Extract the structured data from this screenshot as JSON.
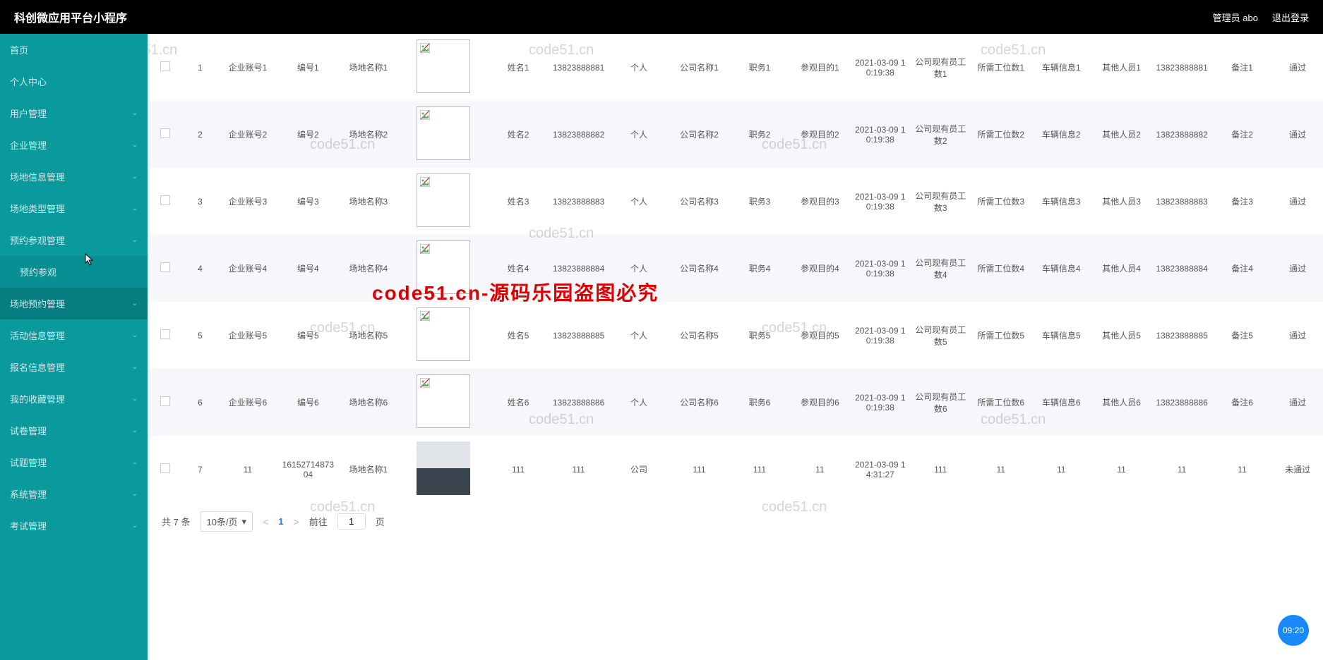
{
  "header": {
    "title": "科创微应用平台小程序",
    "user": "管理员 abo",
    "logout": "退出登录"
  },
  "sidebar": {
    "items": [
      {
        "label": "首页",
        "hasChildren": false
      },
      {
        "label": "个人中心",
        "hasChildren": false
      },
      {
        "label": "用户管理",
        "hasChildren": true
      },
      {
        "label": "企业管理",
        "hasChildren": true
      },
      {
        "label": "场地信息管理",
        "hasChildren": true
      },
      {
        "label": "场地类型管理",
        "hasChildren": true
      },
      {
        "label": "预约参观管理",
        "hasChildren": true,
        "expanded": true,
        "children": [
          {
            "label": "预约参观"
          }
        ]
      },
      {
        "label": "场地预约管理",
        "hasChildren": true,
        "hover": true
      },
      {
        "label": "活动信息管理",
        "hasChildren": true
      },
      {
        "label": "报名信息管理",
        "hasChildren": true
      },
      {
        "label": "我的收藏管理",
        "hasChildren": true
      },
      {
        "label": "试卷管理",
        "hasChildren": true
      },
      {
        "label": "试题管理",
        "hasChildren": true
      },
      {
        "label": "系统管理",
        "hasChildren": true
      },
      {
        "label": "考试管理",
        "hasChildren": true
      }
    ]
  },
  "table": {
    "rows": [
      {
        "idx": "1",
        "c1": "企业账号1",
        "c2": "编号1",
        "c3": "场地名称1",
        "c5": "姓名1",
        "c6": "13823888881",
        "c7": "个人",
        "c8": "公司名称1",
        "c9": "职务1",
        "c10": "参观目的1",
        "c11": "2021-03-09 10:19:38",
        "c12": "公司现有员工数1",
        "c13": "所需工位数1",
        "c14": "车辆信息1",
        "c15": "其他人员1",
        "c16": "13823888881",
        "c17": "备注1",
        "c18": "通过",
        "img": "broken"
      },
      {
        "idx": "2",
        "c1": "企业账号2",
        "c2": "编号2",
        "c3": "场地名称2",
        "c5": "姓名2",
        "c6": "13823888882",
        "c7": "个人",
        "c8": "公司名称2",
        "c9": "职务2",
        "c10": "参观目的2",
        "c11": "2021-03-09 10:19:38",
        "c12": "公司现有员工数2",
        "c13": "所需工位数2",
        "c14": "车辆信息2",
        "c15": "其他人员2",
        "c16": "13823888882",
        "c17": "备注2",
        "c18": "通过",
        "img": "broken"
      },
      {
        "idx": "3",
        "c1": "企业账号3",
        "c2": "编号3",
        "c3": "场地名称3",
        "c5": "姓名3",
        "c6": "13823888883",
        "c7": "个人",
        "c8": "公司名称3",
        "c9": "职务3",
        "c10": "参观目的3",
        "c11": "2021-03-09 10:19:38",
        "c12": "公司现有员工数3",
        "c13": "所需工位数3",
        "c14": "车辆信息3",
        "c15": "其他人员3",
        "c16": "13823888883",
        "c17": "备注3",
        "c18": "通过",
        "img": "broken"
      },
      {
        "idx": "4",
        "c1": "企业账号4",
        "c2": "编号4",
        "c3": "场地名称4",
        "c5": "姓名4",
        "c6": "13823888884",
        "c7": "个人",
        "c8": "公司名称4",
        "c9": "职务4",
        "c10": "参观目的4",
        "c11": "2021-03-09 10:19:38",
        "c12": "公司现有员工数4",
        "c13": "所需工位数4",
        "c14": "车辆信息4",
        "c15": "其他人员4",
        "c16": "13823888884",
        "c17": "备注4",
        "c18": "通过",
        "img": "broken"
      },
      {
        "idx": "5",
        "c1": "企业账号5",
        "c2": "编号5",
        "c3": "场地名称5",
        "c5": "姓名5",
        "c6": "13823888885",
        "c7": "个人",
        "c8": "公司名称5",
        "c9": "职务5",
        "c10": "参观目的5",
        "c11": "2021-03-09 10:19:38",
        "c12": "公司现有员工数5",
        "c13": "所需工位数5",
        "c14": "车辆信息5",
        "c15": "其他人员5",
        "c16": "13823888885",
        "c17": "备注5",
        "c18": "通过",
        "img": "broken"
      },
      {
        "idx": "6",
        "c1": "企业账号6",
        "c2": "编号6",
        "c3": "场地名称6",
        "c5": "姓名6",
        "c6": "13823888886",
        "c7": "个人",
        "c8": "公司名称6",
        "c9": "职务6",
        "c10": "参观目的6",
        "c11": "2021-03-09 10:19:38",
        "c12": "公司现有员工数6",
        "c13": "所需工位数6",
        "c14": "车辆信息6",
        "c15": "其他人员6",
        "c16": "13823888886",
        "c17": "备注6",
        "c18": "通过",
        "img": "broken"
      },
      {
        "idx": "7",
        "c1": "11",
        "c2": "1615271487304",
        "c3": "场地名称1",
        "c5": "111",
        "c6": "111",
        "c7": "公司",
        "c8": "111",
        "c9": "111",
        "c10": "11",
        "c11": "2021-03-09 14:31:27",
        "c12": "111",
        "c13": "11",
        "c14": "11",
        "c15": "11",
        "c16": "11",
        "c17": "11",
        "c18": "未通过",
        "img": "room"
      }
    ]
  },
  "pagination": {
    "total": "共 7 条",
    "perpage": "10条/页",
    "page": "1",
    "goto": "前往",
    "pageunit": "页",
    "inputval": "1"
  },
  "watermarks": {
    "wm": "code51.cn",
    "red": "code51.cn-源码乐园盗图必究"
  },
  "clock": "09:20"
}
